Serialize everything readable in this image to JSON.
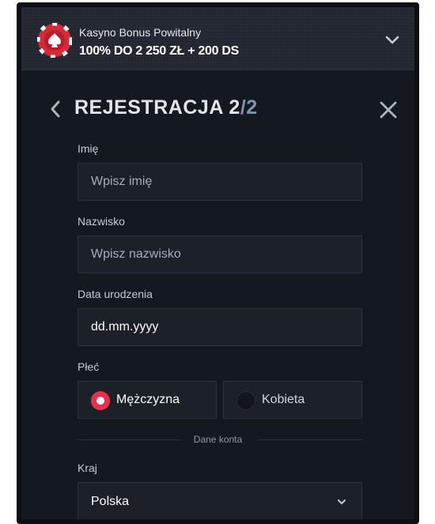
{
  "banner": {
    "subtitle": "Kasyno Bonus Powitalny",
    "headline": "100% DO 2 250 ZŁ + 200 DS",
    "chip_icon": "casino-chip-icon",
    "expand_icon": "chevron-down-icon"
  },
  "header": {
    "title_prefix": "REJESTRACJA ",
    "step_current": "2",
    "step_separator": "/",
    "step_total": "2",
    "back_icon": "chevron-left-icon",
    "close_icon": "close-icon"
  },
  "form": {
    "first_name": {
      "label": "Imię",
      "placeholder": "Wpisz imię",
      "value": ""
    },
    "last_name": {
      "label": "Nazwisko",
      "placeholder": "Wpisz nazwisko",
      "value": ""
    },
    "birth_date": {
      "label": "Data urodzenia",
      "placeholder": "dd.mm.yyyy",
      "value": ""
    },
    "gender": {
      "label": "Płeć",
      "options": [
        {
          "label": "Mężczyzna",
          "selected": true
        },
        {
          "label": "Kobieta",
          "selected": false
        }
      ]
    },
    "section_divider": "Dane konta",
    "country": {
      "label": "Kraj",
      "value": "Polska"
    }
  },
  "colors": {
    "accent": "#e8304e",
    "background": "#141920",
    "field_bg": "#1b2029",
    "step_total": "#7e93ad"
  }
}
